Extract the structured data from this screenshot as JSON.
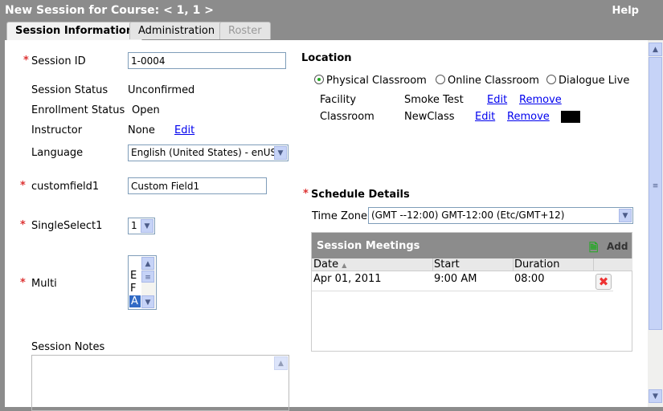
{
  "header": {
    "title": "New Session for Course: < 1, 1 >",
    "help": "Help"
  },
  "tabs": [
    {
      "label": "Session Information",
      "state": "active"
    },
    {
      "label": "Administration",
      "state": "normal"
    },
    {
      "label": "Roster",
      "state": "disabled"
    }
  ],
  "form": {
    "session_id": {
      "label": "Session ID",
      "value": "1-0004",
      "required": true
    },
    "session_status": {
      "label": "Session Status",
      "value": "Unconfirmed"
    },
    "enrollment_status": {
      "label": "Enrollment Status",
      "value": "Open"
    },
    "instructor": {
      "label": "Instructor",
      "value": "None",
      "edit": "Edit"
    },
    "language": {
      "label": "Language",
      "value": "English (United States) - enUS"
    },
    "customfield1": {
      "label": "customfield1",
      "value": "Custom Field1",
      "required": true
    },
    "singleselect1": {
      "label": "SingleSelect1",
      "value": "1",
      "required": true
    },
    "multi": {
      "label": "Multi",
      "required": true,
      "options": [
        "E",
        "F",
        "A"
      ],
      "selected": "A"
    },
    "notes": {
      "label": "Session Notes",
      "value": ""
    }
  },
  "location": {
    "title": "Location",
    "types": [
      {
        "label": "Physical Classroom",
        "checked": true
      },
      {
        "label": "Online Classroom",
        "checked": false
      },
      {
        "label": "Dialogue Live",
        "checked": false
      }
    ],
    "facility": {
      "label": "Facility",
      "value": "Smoke Test",
      "edit": "Edit",
      "remove": "Remove"
    },
    "classroom": {
      "label": "Classroom",
      "value": "NewClass",
      "edit": "Edit",
      "remove": "Remove"
    }
  },
  "schedule": {
    "title": "Schedule Details",
    "timezone_label": "Time Zone",
    "timezone": "(GMT --12:00) GMT-12:00 (Etc/GMT+12)",
    "meetings": {
      "title": "Session Meetings",
      "add": "Add",
      "columns": [
        "Date",
        "Start",
        "Duration"
      ],
      "rows": [
        {
          "date": "Apr 01, 2011",
          "start": "9:00 AM",
          "duration": "08:00"
        }
      ]
    }
  }
}
